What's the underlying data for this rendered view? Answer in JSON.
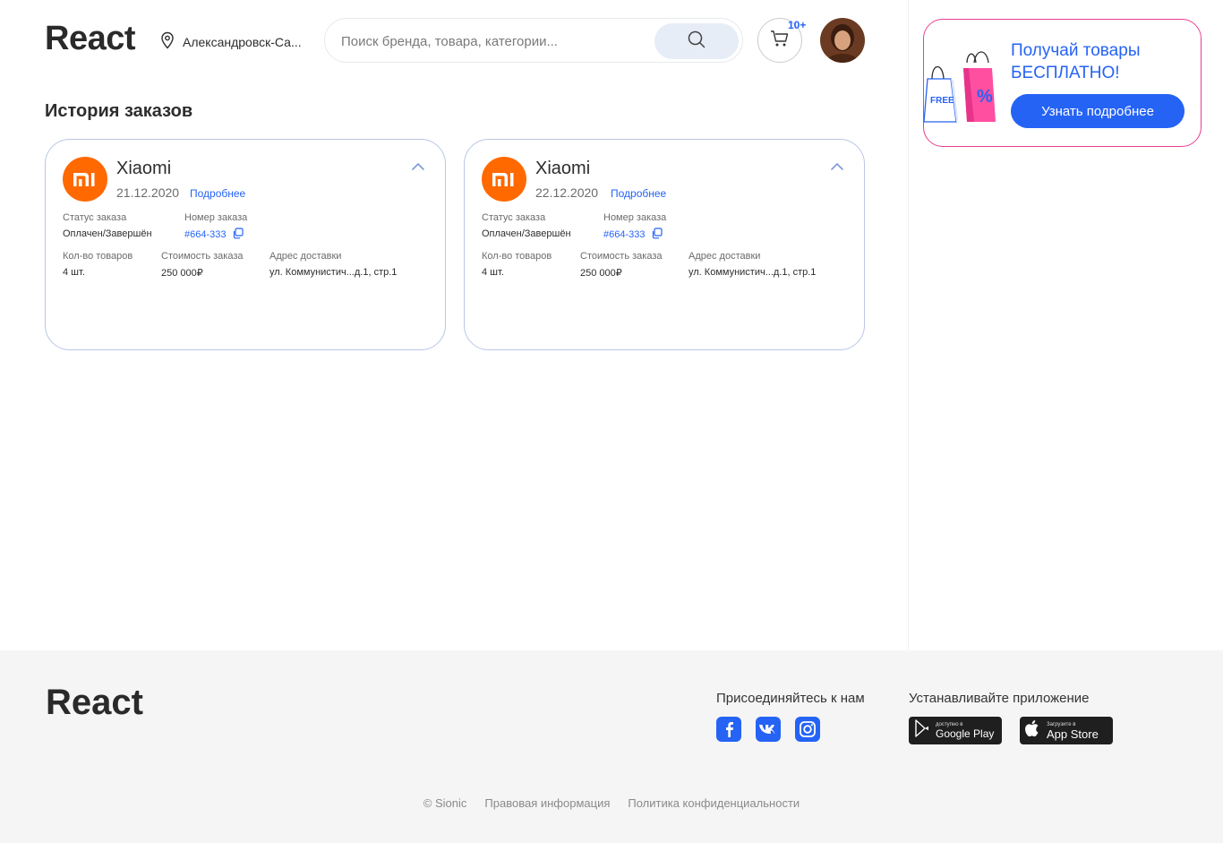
{
  "header": {
    "logo": "React",
    "location": "Александровск-Са...",
    "search_placeholder": "Поиск бренда, товара, категории...",
    "cart_badge": "10+"
  },
  "main": {
    "title": "История заказов",
    "orders": [
      {
        "brand": "Xiaomi",
        "date": "21.12.2020",
        "details_link": "Подробнее",
        "status_label": "Статус заказа",
        "status_value": "Оплачен/Завершён",
        "number_label": "Номер заказа",
        "number_value": "#664-333",
        "qty_label": "Кол-во товаров",
        "qty_value": "4 шт.",
        "cost_label": "Стоимость заказа",
        "cost_value": "250 000₽",
        "address_label": "Адрес доставки",
        "address_value": "ул. Коммунистич...д.1, стр.1"
      },
      {
        "brand": "Xiaomi",
        "date": "22.12.2020",
        "details_link": "Подробнее",
        "status_label": "Статус заказа",
        "status_value": "Оплачен/Завершён",
        "number_label": "Номер заказа",
        "number_value": "#664-333",
        "qty_label": "Кол-во товаров",
        "qty_value": "4 шт.",
        "cost_label": "Стоимость заказа",
        "cost_value": "250 000₽",
        "address_label": "Адрес доставки",
        "address_value": "ул. Коммунистич...д.1, стр.1"
      }
    ]
  },
  "promo": {
    "text_line1": "Получай товары",
    "text_line2": "БЕСПЛАТНО!",
    "button": "Узнать подробнее",
    "bag_label": "FREE",
    "bag_symbol": "%"
  },
  "footer": {
    "logo": "React",
    "social_heading": "Присоединяйтесь к нам",
    "social_icons": [
      "facebook-icon",
      "vk-icon",
      "instagram-icon"
    ],
    "apps_heading": "Устанавливайте приложение",
    "google_play_small": "доступно в",
    "google_play_big": "Google Play",
    "app_store_small": "Загрузите в",
    "app_store_big": "App Store",
    "copyright": "© Sionic",
    "legal": "Правовая информация",
    "privacy": "Политика конфиденциальности"
  },
  "colors": {
    "accent": "#2563f5",
    "brand_orange": "#ff6900",
    "promo_border": "#e6408f",
    "footer_bg": "#f5f5f5"
  }
}
